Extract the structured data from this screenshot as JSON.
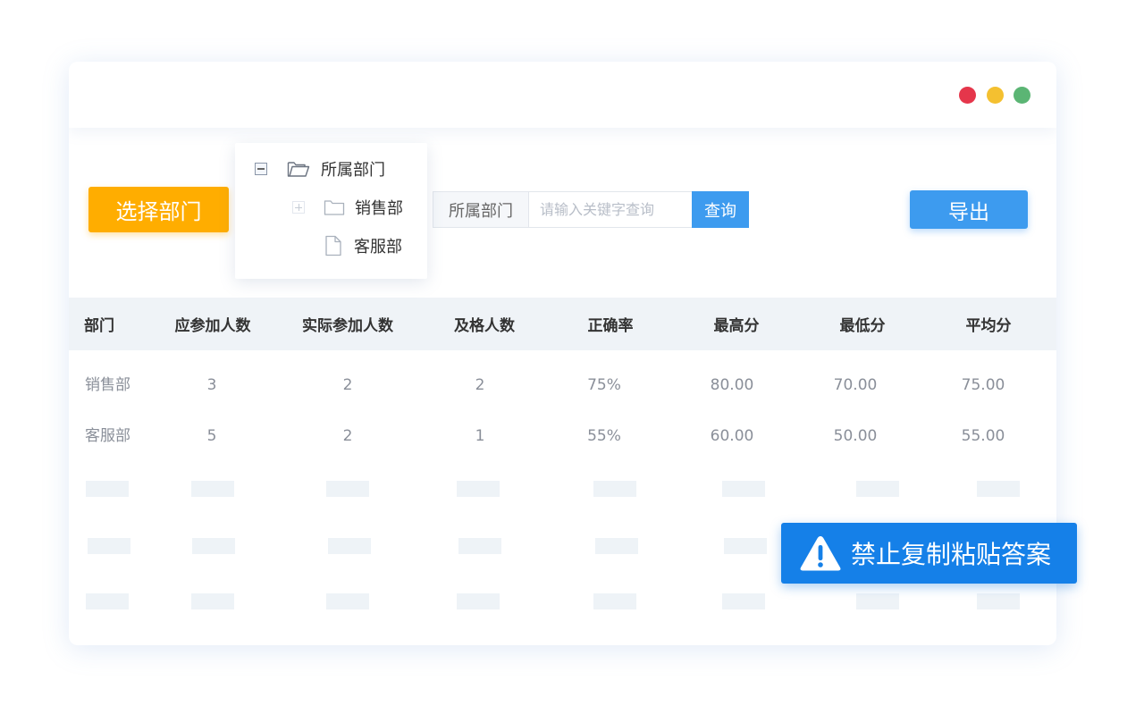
{
  "colors": {
    "window_dot_red": "#e5364b",
    "window_dot_yellow": "#f4c030",
    "window_dot_green": "#5bb574",
    "select_button": "#ffad00",
    "query_button": "#3d9bef",
    "export_button": "#3d9bef",
    "warning_banner": "#1580e8"
  },
  "toolbar": {
    "select_dept_label": "选择部门",
    "search_label": "所属部门",
    "search_placeholder": "请输入关键字查询",
    "search_value": "",
    "query_label": "查询",
    "export_label": "导出"
  },
  "tree": {
    "root": {
      "label": "所属部门",
      "icon": "folder-open-icon",
      "toggle": "minus"
    },
    "children": [
      {
        "label": "销售部",
        "icon": "folder-icon",
        "toggle": "plus"
      },
      {
        "label": "客服部",
        "icon": "file-icon",
        "toggle": null
      }
    ]
  },
  "table": {
    "headers": [
      "部门",
      "应参加人数",
      "实际参加人数",
      "及格人数",
      "正确率",
      "最高分",
      "最低分",
      "平均分"
    ],
    "rows": [
      [
        "销售部",
        "3",
        "2",
        "2",
        "75%",
        "80.00",
        "70.00",
        "75.00"
      ],
      [
        "客服部",
        "5",
        "2",
        "1",
        "55%",
        "60.00",
        "50.00",
        "55.00"
      ]
    ],
    "placeholder_rows": 3
  },
  "warning": {
    "icon": "warning-icon",
    "text": "禁止复制粘贴答案"
  }
}
